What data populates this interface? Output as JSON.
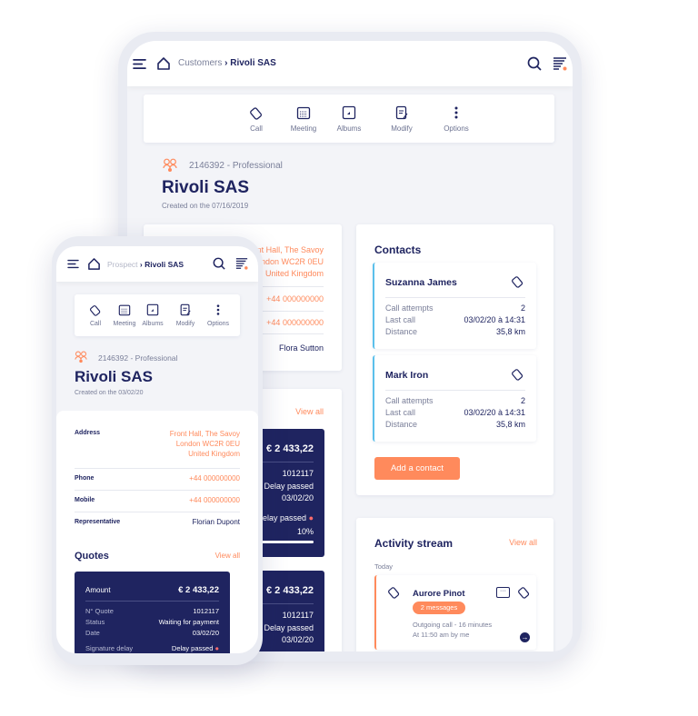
{
  "colors": {
    "navy": "#1f2460",
    "orange": "#ff8a5c",
    "accent_blue": "#5bc0eb",
    "background": "#f3f4f8"
  },
  "tablet": {
    "breadcrumb": {
      "parent": "Customers",
      "current": "Rivoli SAS"
    },
    "actions": [
      {
        "label": "Call",
        "icon": "phone-tag-icon"
      },
      {
        "label": "Meeting",
        "icon": "calendar-icon"
      },
      {
        "label": "Albums",
        "icon": "image-icon"
      },
      {
        "label": "Modify",
        "icon": "edit-document-icon"
      },
      {
        "label": "Options",
        "icon": "more-vertical-icon"
      }
    ],
    "customer": {
      "id_type": "2146392 - Professional",
      "name": "Rivoli SAS",
      "created": "Created on the 07/16/2019"
    },
    "info": {
      "address": [
        "Front Hall, The Savoy",
        "London WC2R 0EU",
        "United Kingdom"
      ],
      "phone": "+44 000000000",
      "mobile": "+44 000000000",
      "representative": "Flora Sutton"
    },
    "quotes": {
      "view_all": "View all",
      "cards": [
        {
          "amount": "€ 2 433,22",
          "quote_no": "1012117",
          "status": "Delay passed",
          "date": "03/02/20",
          "signature": "Delay passed",
          "progress_value": "10%",
          "progress": 10
        },
        {
          "amount": "€ 2 433,22",
          "quote_no": "1012117",
          "status": "Delay passed",
          "date": "03/02/20"
        }
      ]
    },
    "contacts": {
      "title": "Contacts",
      "items": [
        {
          "name": "Suzanna James",
          "call_attempts_label": "Call attempts",
          "call_attempts": "2",
          "last_call_label": "Last call",
          "last_call": "03/02/20 à 14:31",
          "distance_label": "Distance",
          "distance": "35,8 km"
        },
        {
          "name": "Mark Iron",
          "call_attempts_label": "Call attempts",
          "call_attempts": "2",
          "last_call_label": "Last call",
          "last_call": "03/02/20 à 14:31",
          "distance_label": "Distance",
          "distance": "35,8 km"
        }
      ],
      "add_button": "Add a contact"
    },
    "activity": {
      "title": "Activity stream",
      "view_all": "View all",
      "day": "Today",
      "item": {
        "name": "Aurore Pinot",
        "badge": "2 messages",
        "desc": "Outgoing call - 16 minutes",
        "time": "At 11:50 am by me"
      }
    }
  },
  "phone": {
    "breadcrumb": {
      "parent": "Prospect",
      "current": "Rivoli SAS"
    },
    "actions": [
      {
        "label": "Call"
      },
      {
        "label": "Meeting"
      },
      {
        "label": "Albums"
      },
      {
        "label": "Modify"
      },
      {
        "label": "Options"
      }
    ],
    "customer": {
      "id_type": "2146392 - Professional",
      "name": "Rivoli SAS",
      "created": "Created on the 03/02/20"
    },
    "info": {
      "address_label": "Address",
      "address": [
        "Front Hall, The Savoy",
        "London WC2R 0EU",
        "United Kingdom"
      ],
      "phone_label": "Phone",
      "phone": "+44 000000000",
      "mobile_label": "Mobile",
      "mobile": "+44 000000000",
      "representative_label": "Representative",
      "representative": "Florian Dupont"
    },
    "quotes": {
      "title": "Quotes",
      "view_all": "View all",
      "card": {
        "amount_label": "Amount",
        "amount": "€ 2 433,22",
        "quote_no_label": "N° Quote",
        "quote_no": "1012117",
        "status_label": "Status",
        "status": "Waiting for payment",
        "date_label": "Date",
        "date": "03/02/20",
        "signature_label": "Signature delay",
        "signature": "Delay passed"
      }
    }
  }
}
